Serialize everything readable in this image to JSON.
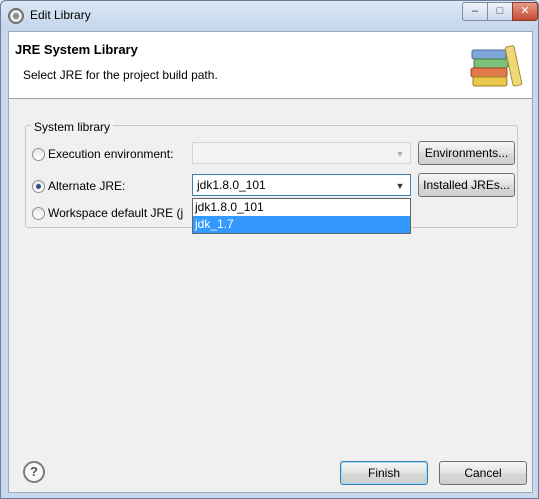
{
  "window": {
    "title": "Edit Library",
    "controls": {
      "minimize": "–",
      "maximize": "□",
      "close": "✕"
    }
  },
  "header": {
    "title": "JRE System Library",
    "description": "Select JRE for the project build path."
  },
  "group": {
    "label": "System library",
    "options": [
      {
        "label": "Execution environment:",
        "checked": false,
        "combo_value": "",
        "enabled": false,
        "button": "Environments..."
      },
      {
        "label": "Alternate JRE:",
        "checked": true,
        "combo_value": "jdk1.8.0_101",
        "enabled": true,
        "button": "Installed JREs..."
      },
      {
        "label": "Workspace default JRE (j",
        "checked": false
      }
    ]
  },
  "dropdown": {
    "items": [
      "jdk1.8.0_101",
      "jdk_1.7"
    ],
    "highlighted_index": 1
  },
  "footer": {
    "help_symbol": "?",
    "finish_label": "Finish",
    "cancel_label": "Cancel"
  },
  "icons": {
    "title": "eclipse-gear-icon",
    "header": "library-books-icon",
    "help": "help-icon",
    "combo_arrow": "chevron-down-icon"
  },
  "colors": {
    "selection": "#3399ff",
    "default_button_border": "#3c7fb1"
  }
}
